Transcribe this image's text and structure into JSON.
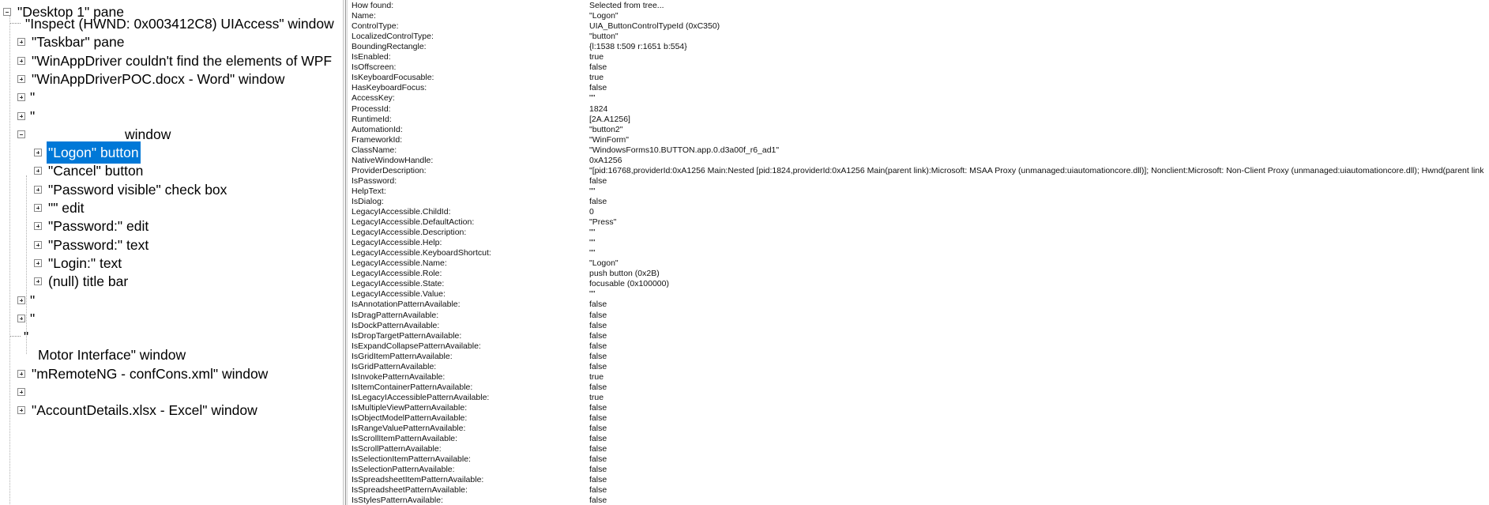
{
  "tree": {
    "root_label": "\"Desktop 1\" pane",
    "items": [
      {
        "label": "\"Inspect  (HWND: 0x003412C8) UIAccess\" window",
        "kind": "leaf",
        "depth": 1
      },
      {
        "label": "\"Taskbar\" pane",
        "kind": "collapsed",
        "depth": 1
      },
      {
        "label": "\"WinAppDriver couldn't find the elements of WPF",
        "kind": "collapsed",
        "depth": 1
      },
      {
        "label": "\"WinAppDriverPOC.docx - Word\" window",
        "kind": "collapsed",
        "depth": 1
      },
      {
        "label": "\"",
        "kind": "collapsed",
        "depth": 1,
        "redacted": true
      },
      {
        "label": "\"",
        "kind": "collapsed",
        "depth": 1,
        "redacted": true
      },
      {
        "label": "window",
        "kind": "expanded",
        "depth": 1,
        "redacted": true
      },
      {
        "label": "\"Logon\" button",
        "kind": "collapsed",
        "depth": 2,
        "selected": true
      },
      {
        "label": "\"Cancel\" button",
        "kind": "collapsed",
        "depth": 2
      },
      {
        "label": "\"Password visible\" check box",
        "kind": "collapsed",
        "depth": 2
      },
      {
        "label": "\"\" edit",
        "kind": "collapsed",
        "depth": 2
      },
      {
        "label": "\"Password:\" edit",
        "kind": "collapsed",
        "depth": 2
      },
      {
        "label": "\"Password:\" text",
        "kind": "collapsed",
        "depth": 2
      },
      {
        "label": "\"Login:\" text",
        "kind": "collapsed",
        "depth": 2
      },
      {
        "label": "(null) title bar",
        "kind": "collapsed",
        "depth": 2
      },
      {
        "label": "\"",
        "kind": "collapsed",
        "depth": 1,
        "redacted": true
      },
      {
        "label": "\"",
        "kind": "collapsed",
        "depth": 1,
        "redacted": true
      },
      {
        "label": "\"",
        "kind": "leaf",
        "depth": 1,
        "redacted": true
      },
      {
        "label": "Motor Interface\" window",
        "kind": "none",
        "depth": 1,
        "redacted": true
      },
      {
        "label": "\"mRemoteNG - confCons.xml\" window",
        "kind": "collapsed",
        "depth": 1
      },
      {
        "label": "",
        "kind": "collapsed",
        "depth": 1,
        "redacted": true
      },
      {
        "label": "\"AccountDetails.xlsx - Excel\" window",
        "kind": "collapsed",
        "depth": 1
      }
    ]
  },
  "properties": [
    {
      "name": "How found:",
      "value": "Selected from tree..."
    },
    {
      "name": "Name:",
      "value": "\"Logon\""
    },
    {
      "name": "ControlType:",
      "value": "UIA_ButtonControlTypeId (0xC350)"
    },
    {
      "name": "LocalizedControlType:",
      "value": "\"button\""
    },
    {
      "name": "BoundingRectangle:",
      "value": "{l:1538 t:509 r:1651 b:554}"
    },
    {
      "name": "IsEnabled:",
      "value": "true"
    },
    {
      "name": "IsOffscreen:",
      "value": "false"
    },
    {
      "name": "IsKeyboardFocusable:",
      "value": "true"
    },
    {
      "name": "HasKeyboardFocus:",
      "value": "false"
    },
    {
      "name": "AccessKey:",
      "value": "\"\""
    },
    {
      "name": "ProcessId:",
      "value": "1824"
    },
    {
      "name": "RuntimeId:",
      "value": "[2A.A1256]"
    },
    {
      "name": "AutomationId:",
      "value": "\"button2\""
    },
    {
      "name": "FrameworkId:",
      "value": "\"WinForm\""
    },
    {
      "name": "ClassName:",
      "value": "\"WindowsForms10.BUTTON.app.0.d3a00f_r6_ad1\""
    },
    {
      "name": "NativeWindowHandle:",
      "value": "0xA1256"
    },
    {
      "name": "ProviderDescription:",
      "value": "\"[pid:16768,providerId:0xA1256 Main:Nested [pid:1824,providerId:0xA1256 Main(parent link):Microsoft: MSAA Proxy (unmanaged:uiautomationcore.dll)]; Nonclient:Microsoft: Non-Client Proxy (unmanaged:uiautomationcore.dll); Hwnd(parent link"
    },
    {
      "name": "IsPassword:",
      "value": "false"
    },
    {
      "name": "HelpText:",
      "value": "\"\""
    },
    {
      "name": "IsDialog:",
      "value": "false"
    },
    {
      "name": "LegacyIAccessible.ChildId:",
      "value": "0"
    },
    {
      "name": "LegacyIAccessible.DefaultAction:",
      "value": "\"Press\""
    },
    {
      "name": "LegacyIAccessible.Description:",
      "value": "\"\""
    },
    {
      "name": "LegacyIAccessible.Help:",
      "value": "\"\""
    },
    {
      "name": "LegacyIAccessible.KeyboardShortcut:",
      "value": "\"\""
    },
    {
      "name": "LegacyIAccessible.Name:",
      "value": "\"Logon\""
    },
    {
      "name": "LegacyIAccessible.Role:",
      "value": "push button (0x2B)"
    },
    {
      "name": "LegacyIAccessible.State:",
      "value": "focusable (0x100000)"
    },
    {
      "name": "LegacyIAccessible.Value:",
      "value": "\"\""
    },
    {
      "name": "IsAnnotationPatternAvailable:",
      "value": "false"
    },
    {
      "name": "IsDragPatternAvailable:",
      "value": "false"
    },
    {
      "name": "IsDockPatternAvailable:",
      "value": "false"
    },
    {
      "name": "IsDropTargetPatternAvailable:",
      "value": "false"
    },
    {
      "name": "IsExpandCollapsePatternAvailable:",
      "value": "false"
    },
    {
      "name": "IsGridItemPatternAvailable:",
      "value": "false"
    },
    {
      "name": "IsGridPatternAvailable:",
      "value": "false"
    },
    {
      "name": "IsInvokePatternAvailable:",
      "value": "true"
    },
    {
      "name": "IsItemContainerPatternAvailable:",
      "value": "false"
    },
    {
      "name": "IsLegacyIAccessiblePatternAvailable:",
      "value": "true"
    },
    {
      "name": "IsMultipleViewPatternAvailable:",
      "value": "false"
    },
    {
      "name": "IsObjectModelPatternAvailable:",
      "value": "false"
    },
    {
      "name": "IsRangeValuePatternAvailable:",
      "value": "false"
    },
    {
      "name": "IsScrollItemPatternAvailable:",
      "value": "false"
    },
    {
      "name": "IsScrollPatternAvailable:",
      "value": "false"
    },
    {
      "name": "IsSelectionItemPatternAvailable:",
      "value": "false"
    },
    {
      "name": "IsSelectionPatternAvailable:",
      "value": "false"
    },
    {
      "name": "IsSpreadsheetItemPatternAvailable:",
      "value": "false"
    },
    {
      "name": "IsSpreadsheetPatternAvailable:",
      "value": "false"
    },
    {
      "name": "IsStylesPatternAvailable:",
      "value": "false"
    }
  ],
  "colors": {
    "selection": "#0078d7",
    "selection_text": "#ffffff"
  }
}
